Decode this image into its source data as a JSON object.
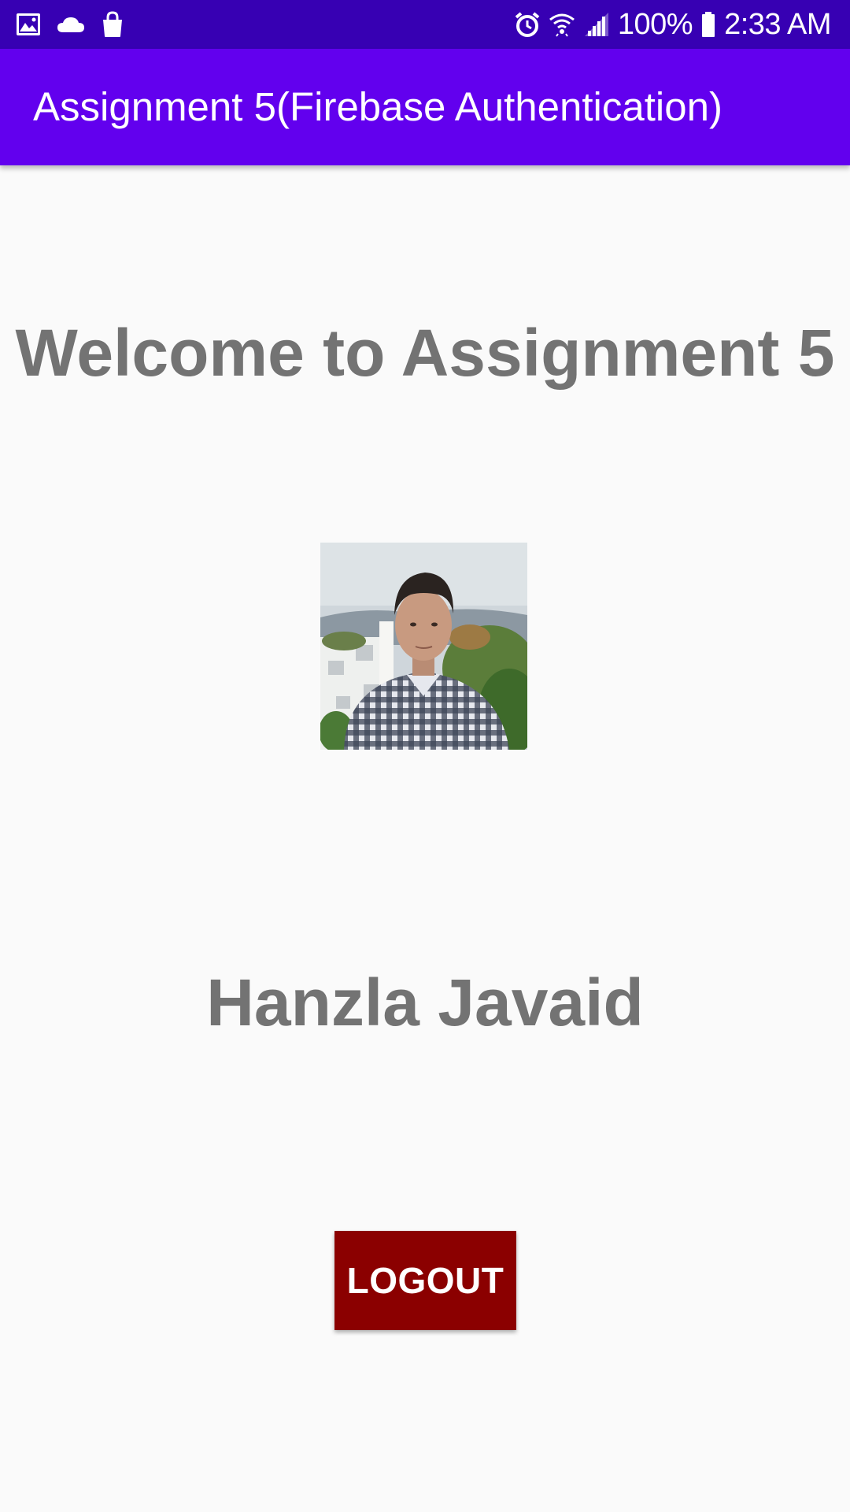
{
  "status_bar": {
    "left_icons": [
      "gallery-icon",
      "cloud-icon",
      "shopping-bag-icon"
    ],
    "right_icons": [
      "alarm-icon",
      "wifi-icon",
      "signal-icon",
      "battery-icon"
    ],
    "battery": "100%",
    "time": "2:33 AM"
  },
  "app_bar": {
    "title": "Assignment 5(Firebase Authentication)"
  },
  "main": {
    "welcome_text": "Welcome to Assignment 5",
    "user_name": "Hanzla Javaid",
    "logout_label": "LOGOUT"
  },
  "colors": {
    "status_bar": "#3700b3",
    "app_bar": "#6200ee",
    "background": "#fafafa",
    "text_gray": "#737373",
    "logout_button": "#8b0000"
  }
}
